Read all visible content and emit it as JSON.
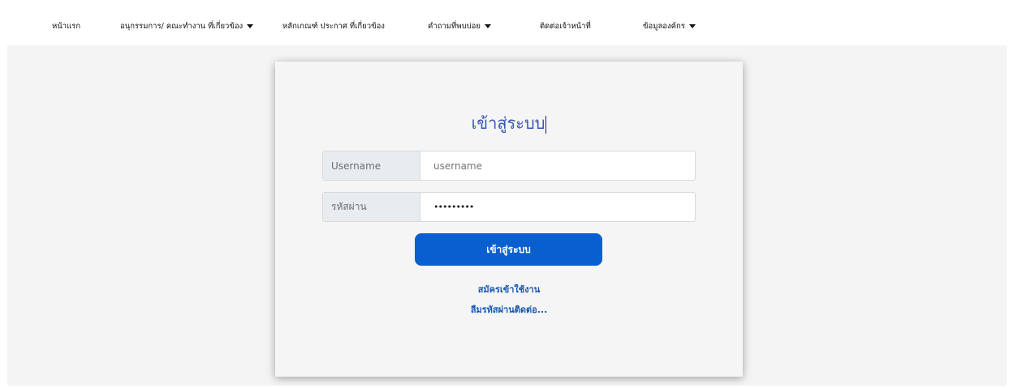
{
  "nav": {
    "items": [
      {
        "label": "หน้าแรก",
        "dropdown": false
      },
      {
        "label": "อนุกรรมการ/ คณะทำงาน ที่เกี่ยวข้อง",
        "dropdown": true
      },
      {
        "label": "หลักเกณฑ์ ประกาศ ที่เกี่ยวข้อง",
        "dropdown": false
      },
      {
        "label": "คำถามที่พบบ่อย",
        "dropdown": true
      },
      {
        "label": "ติดต่อเจ้าหน้าที่",
        "dropdown": false
      },
      {
        "label": "ข้อมูลองค์กร",
        "dropdown": true
      }
    ]
  },
  "login": {
    "title": "เข้าสู่ระบบ",
    "username_label": "Username",
    "username_placeholder": "username",
    "password_label": "รหัสผ่าน",
    "password_value": "•••••••••",
    "submit_label": "เข้าสู่ระบบ",
    "register_link": "สมัครเข้าใช้งาน",
    "forgot_link": "ลืมรหัสผ่านติดต่อ..."
  },
  "colors": {
    "accent": "#0a5fd0",
    "link": "#1557b0",
    "title": "#3a55b8",
    "background": "#f4f4f4"
  }
}
